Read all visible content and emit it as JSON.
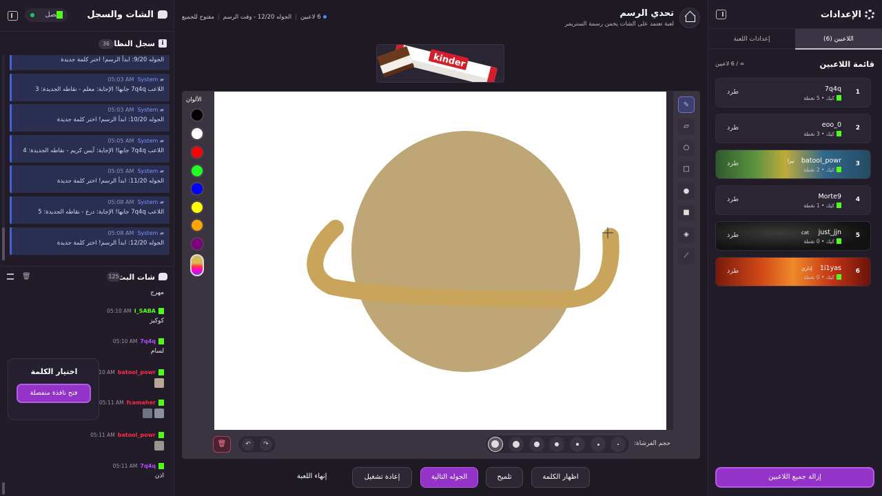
{
  "left_panel": {
    "title": "الشات والسجل",
    "status": "متصل",
    "log": {
      "title": "سجل النظام",
      "count": "36",
      "items": [
        {
          "meta": "",
          "text": "الجوله 9/20: ابدأ الرسم! اختر كلمة جديدة"
        },
        {
          "meta": "05:03 AM",
          "sender": "System",
          "text": "اللاعب 7q4q جابها! الإجابة: معلم - نقاطه الجديدة: 3"
        },
        {
          "meta": "05:03 AM",
          "sender": "System",
          "text": "الجوله 10/20: ابدأ الرسم! اختر كلمة جديدة"
        },
        {
          "meta": "05:05 AM",
          "sender": "System",
          "text": "اللاعب 7q4q جابها! الإجابة: آيس كريم - نقاطه الجديدة: 4"
        },
        {
          "meta": "05:05 AM",
          "sender": "System",
          "text": "الجوله 11/20: ابدأ الرسم! اختر كلمة جديدة"
        },
        {
          "meta": "05:08 AM",
          "sender": "System",
          "text": "اللاعب 7q4q جابها! الإجابة: درع - نقاطه الجديدة: 5"
        },
        {
          "meta": "05:08 AM",
          "sender": "System",
          "text": "الجوله 12/20: ابدأ الرسم! اختر كلمة جديدة"
        }
      ]
    },
    "stream_chat": {
      "title": "شات البث",
      "count": "125",
      "messages": [
        {
          "user": "",
          "time": "",
          "text": "مهرج"
        },
        {
          "user": "I_SABA",
          "time": "05:10 AM",
          "text": "كوكيز",
          "color": "#53fc18"
        },
        {
          "user": "7q4q",
          "time": "05:10 AM",
          "text": "لسام",
          "color": "#b44cff"
        },
        {
          "user": "batool_powr",
          "time": "05:10 AM",
          "text": "",
          "color": "#ff2a4a"
        },
        {
          "user": "fcamaher",
          "time": "05:11 AM",
          "text": "",
          "color": "#ff2a4a"
        },
        {
          "user": "batool_powr",
          "time": "05:11 AM",
          "text": "",
          "color": "#ff2a4a"
        },
        {
          "user": "7q4q",
          "time": "05:11 AM",
          "text": "اذن",
          "color": "#b44cff"
        }
      ]
    },
    "word_card": {
      "title": "اختيار الكلمة",
      "button": "فتح نافذة منفصلة"
    }
  },
  "game": {
    "title": "تحدي الرسم",
    "subtitle": "لعبة تعتمد على الشات يخمن رسمة الستريمر",
    "players_info": "6 لاعبين",
    "round_info": "الجوله 12/20 - وقت الرسم",
    "open_info": "مفتوح للجميع",
    "word_image_alt": "kinder"
  },
  "canvas": {
    "colors_label": "الألوان",
    "colors": [
      "#000000",
      "#ffffff",
      "#ff0000",
      "#22ff22",
      "#0000ff",
      "#ffff00",
      "#ffa500",
      "#800080"
    ],
    "drawing": {
      "circle_color": "#bea676",
      "ring_color": "#c9a55c"
    },
    "brush_label": "حجم الفرشاة:",
    "tools": [
      "pencil-icon",
      "eraser-icon",
      "circle-outline-icon",
      "square-outline-icon",
      "circle-fill-icon",
      "square-fill-icon",
      "fill-bucket-icon",
      "line-icon"
    ]
  },
  "actions": {
    "show_word": "اظهار الكلمة",
    "hint": "تلميح",
    "next_round": "الجوله التالية",
    "restart": "إعادة تشغيل",
    "end_game": "إنهاء اللعبة"
  },
  "right_panel": {
    "title": "الإعدادات",
    "tab_players": "اللاعبين (6)",
    "tab_settings": "إعدادات اللعبة",
    "players_heading": "قائمة اللاعبين",
    "players_cap": "∞ / 6 لاعبين",
    "kick_label": "طرد",
    "players": [
      {
        "rank": "1",
        "name": "7q4q",
        "sub": "كيك • 5 نقطة",
        "tag": "",
        "bg": "#2a2532"
      },
      {
        "rank": "2",
        "name": "eoo_0",
        "sub": "كيك • 3 نقطة",
        "tag": "",
        "bg": "#2a2532"
      },
      {
        "rank": "3",
        "name": "batool_powr",
        "sub": "كيك • 2 نقطة",
        "tag": "تيرا",
        "bg": "spongebob"
      },
      {
        "rank": "4",
        "name": "Morte9",
        "sub": "كيك • 1 نقطة",
        "tag": "",
        "bg": "#2a2532"
      },
      {
        "rank": "5",
        "name": "just_jjn",
        "sub": "كيك • 0 نقطة",
        "tag": "cat",
        "bg": "dark"
      },
      {
        "rank": "6",
        "name": "1i1yas",
        "sub": "كيك • 0 نقطة",
        "tag": "إداري",
        "bg": "fire"
      }
    ],
    "remove_all": "إزالة جميع اللاعبين"
  }
}
